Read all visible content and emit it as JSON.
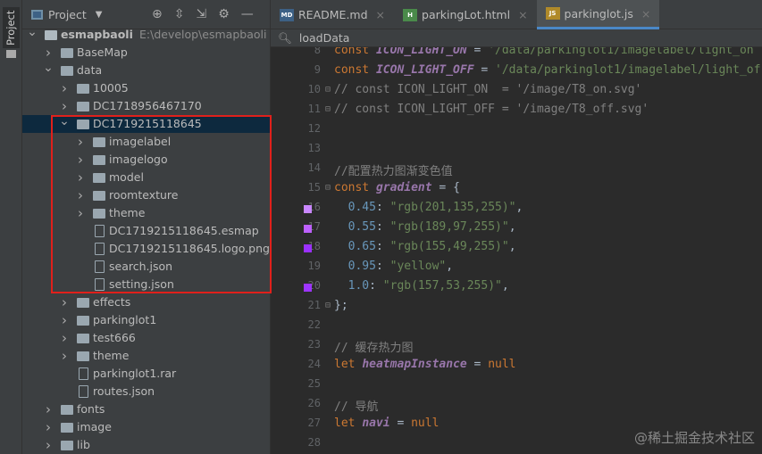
{
  "sidebar_tab": "Project",
  "project": {
    "title": "Project",
    "root": "esmapbaoli",
    "root_path": "E:\\develop\\esmapbaoli",
    "tree": [
      {
        "label": "esmapbaoli",
        "level": 0,
        "type": "root",
        "open": true
      },
      {
        "label": "BaseMap",
        "level": 1,
        "type": "folder"
      },
      {
        "label": "data",
        "level": 1,
        "type": "folder",
        "open": true
      },
      {
        "label": "10005",
        "level": 2,
        "type": "folder"
      },
      {
        "label": "DC1718956467170",
        "level": 2,
        "type": "folder"
      },
      {
        "label": "DC1719215118645",
        "level": 2,
        "type": "folder",
        "open": true,
        "selected": true
      },
      {
        "label": "imagelabel",
        "level": 3,
        "type": "folder"
      },
      {
        "label": "imagelogo",
        "level": 3,
        "type": "folder"
      },
      {
        "label": "model",
        "level": 3,
        "type": "folder"
      },
      {
        "label": "roomtexture",
        "level": 3,
        "type": "folder"
      },
      {
        "label": "theme",
        "level": 3,
        "type": "folder"
      },
      {
        "label": "DC1719215118645.esmap",
        "level": 3,
        "type": "file"
      },
      {
        "label": "DC1719215118645.logo.png",
        "level": 3,
        "type": "file"
      },
      {
        "label": "search.json",
        "level": 3,
        "type": "file"
      },
      {
        "label": "setting.json",
        "level": 3,
        "type": "file"
      },
      {
        "label": "effects",
        "level": 2,
        "type": "folder"
      },
      {
        "label": "parkinglot1",
        "level": 2,
        "type": "folder"
      },
      {
        "label": "test666",
        "level": 2,
        "type": "folder"
      },
      {
        "label": "theme",
        "level": 2,
        "type": "folder"
      },
      {
        "label": "parkinglot1.rar",
        "level": 2,
        "type": "file"
      },
      {
        "label": "routes.json",
        "level": 2,
        "type": "file"
      },
      {
        "label": "fonts",
        "level": 1,
        "type": "folder"
      },
      {
        "label": "image",
        "level": 1,
        "type": "folder"
      },
      {
        "label": "lib",
        "level": 1,
        "type": "folder"
      }
    ]
  },
  "tabs": [
    {
      "label": "README.md",
      "icon": "MD",
      "color": "#3d6185"
    },
    {
      "label": "parkingLot.html",
      "icon": "H",
      "color": "#4a8a4a"
    },
    {
      "label": "parkinglot.js",
      "icon": "JS",
      "color": "#b08a2a",
      "active": true
    }
  ],
  "search": {
    "value": "loadData"
  },
  "code": [
    {
      "n": "8",
      "t": [
        [
          "kw",
          "const "
        ],
        [
          "cn",
          "ICON_LIGHT_ON"
        ],
        [
          "pl",
          " = "
        ],
        [
          "st",
          "'/data/parkinglot1/imagelabel/light_on"
        ]
      ]
    },
    {
      "n": "9",
      "t": [
        [
          "kw",
          "const "
        ],
        [
          "cn",
          "ICON_LIGHT_OFF"
        ],
        [
          "pl",
          " = "
        ],
        [
          "st",
          "'/data/parkinglot1/imagelabel/light_of"
        ]
      ]
    },
    {
      "n": "10",
      "fold": true,
      "t": [
        [
          "cm",
          "// const ICON_LIGHT_ON  = '/image/T8_on.svg'"
        ]
      ]
    },
    {
      "n": "11",
      "fold": true,
      "t": [
        [
          "cm",
          "// const ICON_LIGHT_OFF = '/image/T8_off.svg'"
        ]
      ]
    },
    {
      "n": "12",
      "t": []
    },
    {
      "n": "13",
      "t": []
    },
    {
      "n": "14",
      "t": [
        [
          "cm",
          "//配置热力图渐变色值"
        ]
      ]
    },
    {
      "n": "15",
      "fold": true,
      "t": [
        [
          "kw",
          "const "
        ],
        [
          "cn",
          "gradient"
        ],
        [
          "pl",
          " = {"
        ]
      ]
    },
    {
      "n": "16",
      "sw": "#c987ff",
      "t": [
        [
          "nm",
          "  0.45"
        ],
        [
          "pl",
          ": "
        ],
        [
          "st",
          "\"rgb(201,135,255)\""
        ],
        [
          "pl",
          ","
        ]
      ]
    },
    {
      "n": "17",
      "sw": "#bd61ff",
      "t": [
        [
          "nm",
          "  0.55"
        ],
        [
          "pl",
          ": "
        ],
        [
          "st",
          "\"rgb(189,97,255)\""
        ],
        [
          "pl",
          ","
        ]
      ]
    },
    {
      "n": "18",
      "sw": "#9b31ff",
      "t": [
        [
          "nm",
          "  0.65"
        ],
        [
          "pl",
          ": "
        ],
        [
          "st",
          "\"rgb(155,49,255)\""
        ],
        [
          "pl",
          ","
        ]
      ]
    },
    {
      "n": "19",
      "t": [
        [
          "nm",
          "  0.95"
        ],
        [
          "pl",
          ": "
        ],
        [
          "st",
          "\"yellow\""
        ],
        [
          "pl",
          ","
        ]
      ]
    },
    {
      "n": "20",
      "sw": "#9d35ff",
      "t": [
        [
          "nm",
          "  1.0"
        ],
        [
          "pl",
          ": "
        ],
        [
          "st",
          "\"rgb(157,53,255)\""
        ],
        [
          "pl",
          ","
        ]
      ]
    },
    {
      "n": "21",
      "fold": true,
      "t": [
        [
          "pl",
          "};"
        ]
      ]
    },
    {
      "n": "22",
      "t": []
    },
    {
      "n": "23",
      "t": [
        [
          "cm",
          "// 缓存热力图"
        ]
      ]
    },
    {
      "n": "24",
      "t": [
        [
          "kw",
          "let "
        ],
        [
          "cn",
          "heatmapInstance"
        ],
        [
          "pl",
          " = "
        ],
        [
          "kw",
          "null"
        ]
      ]
    },
    {
      "n": "25",
      "t": []
    },
    {
      "n": "26",
      "t": [
        [
          "cm",
          "// 导航"
        ]
      ]
    },
    {
      "n": "27",
      "t": [
        [
          "kw",
          "let "
        ],
        [
          "cn",
          "navi"
        ],
        [
          "pl",
          " = "
        ],
        [
          "kw",
          "null"
        ]
      ]
    },
    {
      "n": "28",
      "t": []
    }
  ],
  "watermark": "@稀土掘金技术社区"
}
